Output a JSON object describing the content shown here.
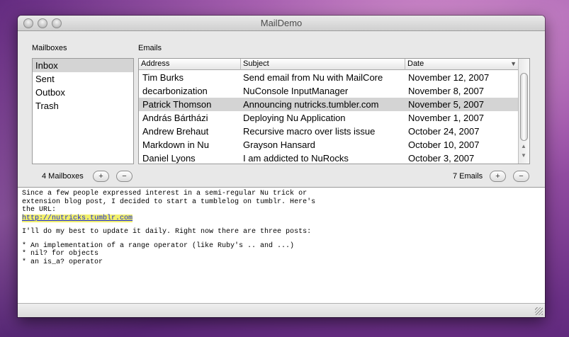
{
  "window": {
    "title": "MailDemo"
  },
  "mailboxes": {
    "label": "Mailboxes",
    "items": [
      {
        "name": "Inbox",
        "selected": true
      },
      {
        "name": "Sent",
        "selected": false
      },
      {
        "name": "Outbox",
        "selected": false
      },
      {
        "name": "Trash",
        "selected": false
      }
    ],
    "count_label": "4 Mailboxes",
    "add_label": "+",
    "remove_label": "−"
  },
  "emails": {
    "label": "Emails",
    "columns": {
      "address": "Address",
      "subject": "Subject",
      "date": "Date"
    },
    "rows": [
      {
        "address": "Tim Burks",
        "subject": "Send email from Nu with MailCore",
        "date": "November 12, 2007",
        "selected": false
      },
      {
        "address": "decarbonization",
        "subject": "NuConsole InputManager",
        "date": "November 8, 2007",
        "selected": false
      },
      {
        "address": "Patrick Thomson",
        "subject": "Announcing nutricks.tumbler.com",
        "date": "November 5, 2007",
        "selected": true
      },
      {
        "address": "András Bártházi",
        "subject": "Deploying Nu Application",
        "date": "November 1, 2007",
        "selected": false
      },
      {
        "address": "Andrew Brehaut",
        "subject": "Recursive macro over lists issue",
        "date": "October 24, 2007",
        "selected": false
      },
      {
        "address": "Markdown in Nu",
        "subject": "Grayson Hansard",
        "date": "October 10, 2007",
        "selected": false
      },
      {
        "address": "Daniel Lyons",
        "subject": "I am addicted to NuRocks",
        "date": "October 3, 2007",
        "selected": false
      }
    ],
    "count_label": "7 Emails",
    "add_label": "+",
    "remove_label": "−"
  },
  "message": {
    "intro_lines": [
      "Since a few people expressed interest in a semi-regular Nu trick or",
      "extension blog post, I decided to start a tumblelog on tumblr. Here's",
      "the URL:"
    ],
    "link": "http://nutricks.tumblr.com",
    "line_update": "I'll do my best to update it daily. Right now there are three posts:",
    "bullets": [
      "* An implementation of a range operator (like Ruby's .. and ...)",
      "* nil? for objects",
      "* an is_a? operator"
    ]
  },
  "colors": {
    "selection": "#d4d4d4",
    "link": "#1a2ad8",
    "link_highlight": "#f2f06a"
  },
  "icons": {
    "sort": "triangle-down-icon",
    "resize": "resize-grip-icon"
  }
}
